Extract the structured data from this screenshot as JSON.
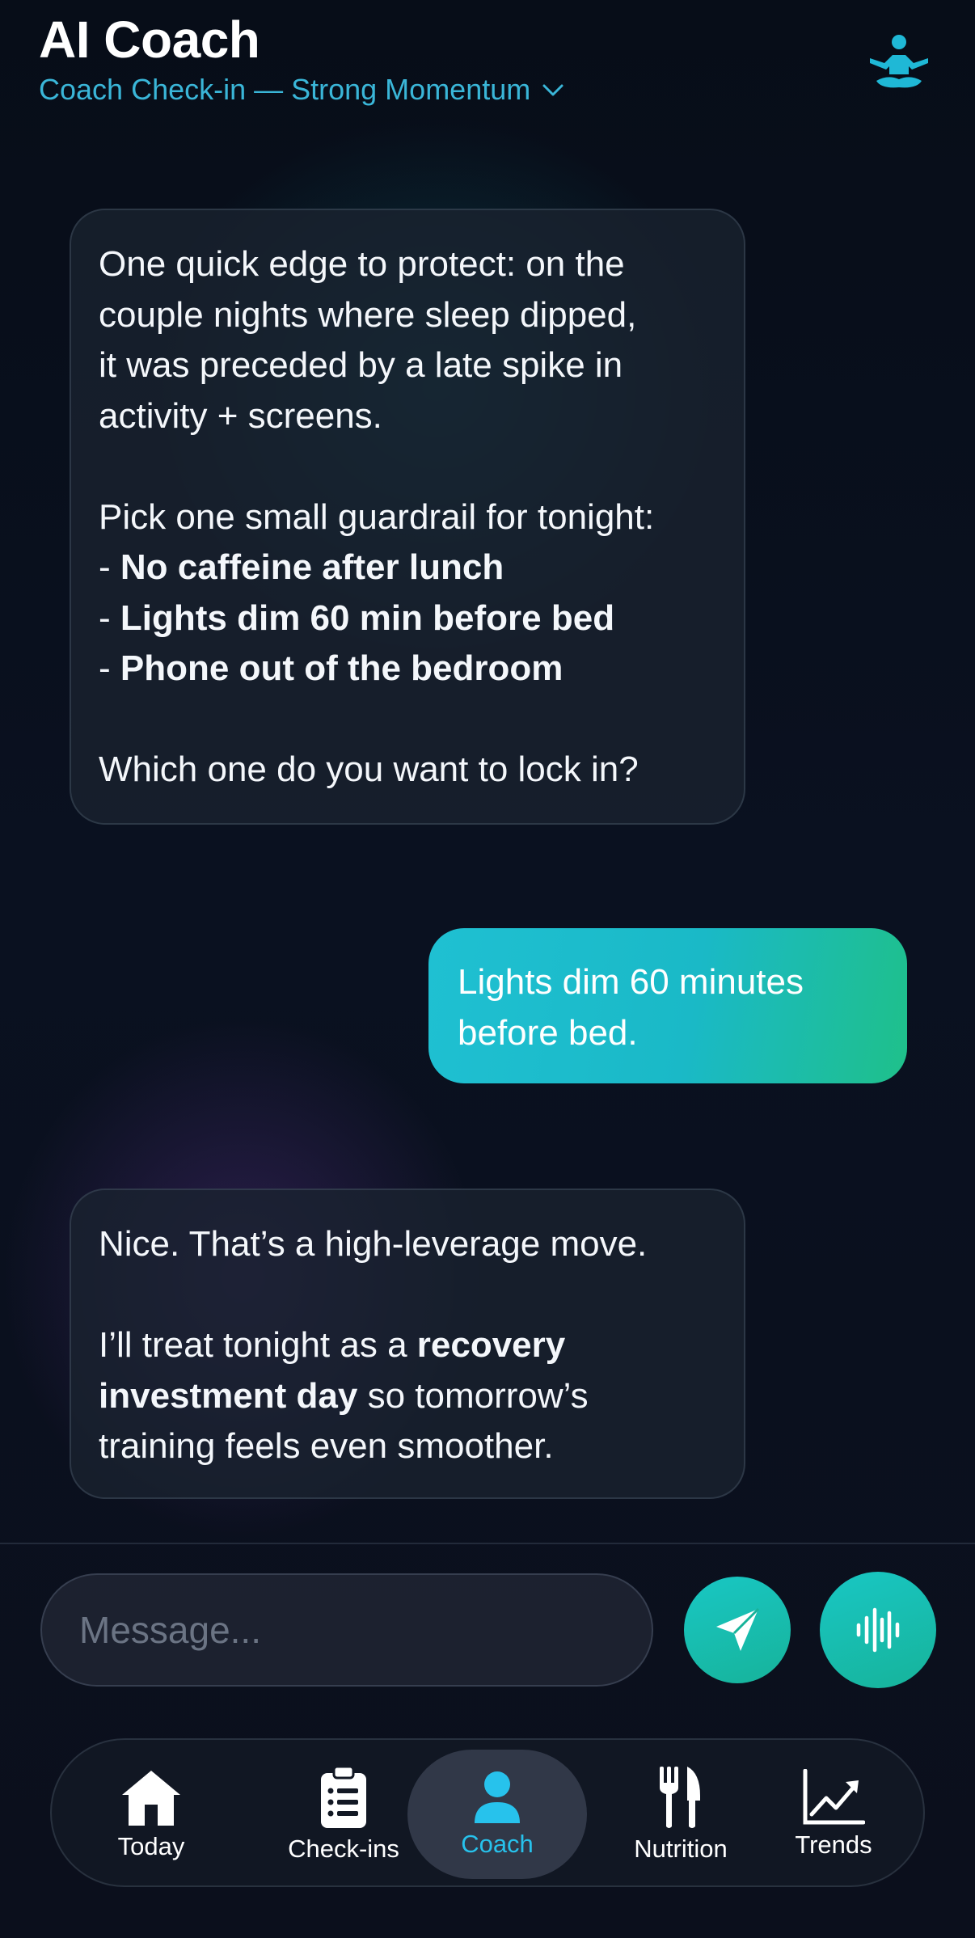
{
  "header": {
    "title": "AI Coach",
    "subtitle": "Coach Check-in — Strong Momentum"
  },
  "messages": [
    {
      "sender": "coach",
      "lines": [
        "One quick edge to protect: on the",
        "couple nights where sleep dipped,",
        "it was preceded by a late spike in",
        "activity + screens.",
        "Pick one small guardrail for tonight:",
        "No caffeine after lunch",
        "Lights dim 60 min before bed",
        "Phone out of the bedroom",
        "Which one do you want to lock in?"
      ],
      "bullet_prefix": "- "
    },
    {
      "sender": "user",
      "lines": [
        "Lights dim 60 minutes",
        "before bed."
      ]
    },
    {
      "sender": "coach",
      "lines": [
        "Nice. That’s a high-leverage move.",
        "I’ll treat tonight as a ",
        "recovery",
        "investment day",
        " so tomorrow’s",
        "training feels even smoother."
      ]
    }
  ],
  "composer": {
    "placeholder": "Message...",
    "value": ""
  },
  "actions": {
    "send_icon": "paper-plane-icon",
    "voice_icon": "waveform-icon"
  },
  "tabs": [
    {
      "label": "Today",
      "icon": "house-icon"
    },
    {
      "label": "Check-ins",
      "icon": "clipboard-icon"
    },
    {
      "label": "Coach",
      "icon": "person-icon",
      "active": true
    },
    {
      "label": "Nutrition",
      "icon": "fork-knife-icon"
    },
    {
      "label": "Trends",
      "icon": "trend-chart-icon"
    }
  ],
  "colors": {
    "accent": "#27c2ec",
    "subtitle": "#3ab6d8",
    "user_bubble_start": "#1fc0d2",
    "user_bubble_end": "#1fc08a",
    "action_button": "#17b39a"
  }
}
